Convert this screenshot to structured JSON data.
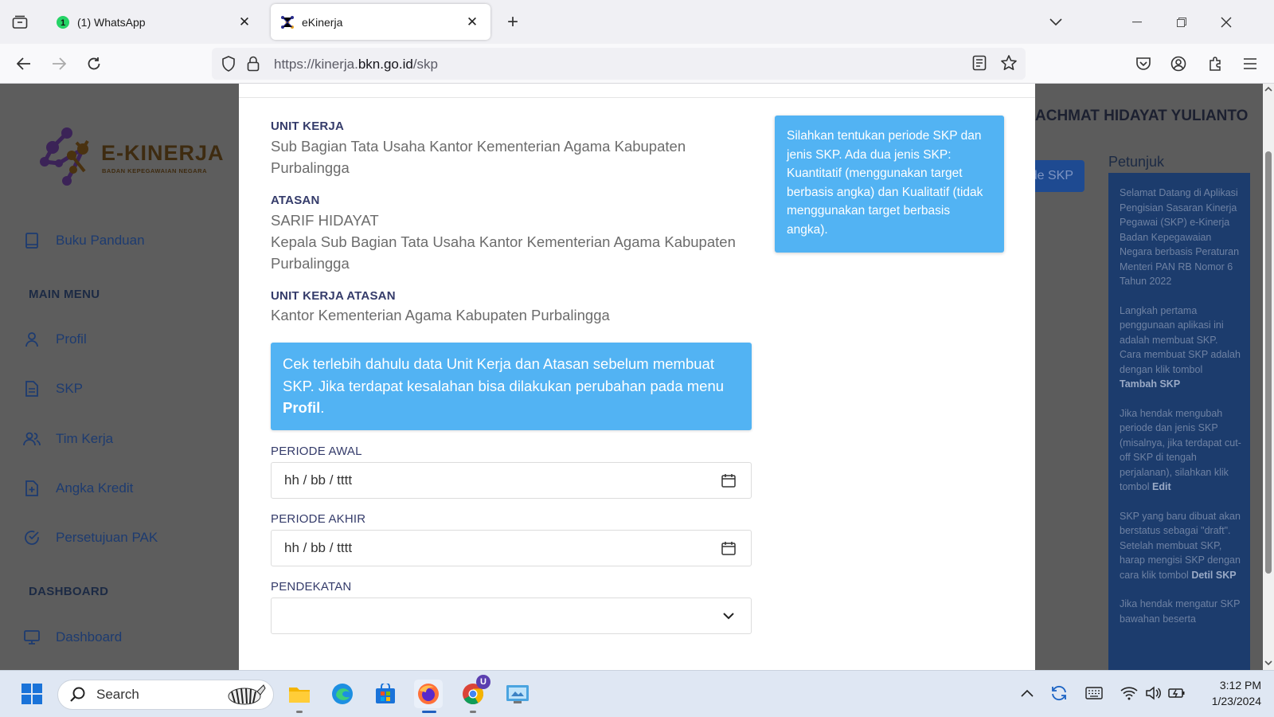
{
  "browser": {
    "tabs": [
      {
        "title": "(1) WhatsApp",
        "active": false
      },
      {
        "title": "eKinerja",
        "active": true
      }
    ],
    "url_prefix": "https://kinerja.",
    "url_domain": "bkn.go.id",
    "url_path": "/skp"
  },
  "sidebar": {
    "logo_word": "E-KINERJA",
    "logo_sub": "BADAN KEPEGAWAIAN NEGARA",
    "buku_panduan": "Buku Panduan",
    "main_menu_heading": "MAIN MENU",
    "items": [
      {
        "label": "Profil",
        "icon": "user-icon"
      },
      {
        "label": "SKP",
        "icon": "document-icon"
      },
      {
        "label": "Tim Kerja",
        "icon": "users-icon"
      },
      {
        "label": "Angka Kredit",
        "icon": "file-plus-icon"
      },
      {
        "label": "Persetujuan PAK",
        "icon": "check-circle-icon"
      }
    ],
    "dashboard_heading": "DASHBOARD",
    "dashboard": "Dashboard"
  },
  "background": {
    "username": "ACHMAT HIDAYAT YULIANTO",
    "add_button_fragment": "de SKP",
    "petunjuk_title": "Petunjuk",
    "petunjuk": {
      "p1": "Selamat Datang di Aplikasi Pengisian Sasaran Kinerja Pegawai (SKP) e-Kinerja Badan Kepegawaian Negara berbasis Peraturan Menteri PAN RB Nomor 6 Tahun 2022",
      "p2_pre": "Langkah pertama penggunaan aplikasi ini adalah membuat SKP. Cara membuat SKP adalah dengan klik tombol ",
      "p2_bold": "Tambah SKP",
      "p3_pre": "Jika hendak mengubah periode dan jenis SKP (misalnya, jika terdapat cut-off SKP di tengah perjalanan), silahkan klik tombol ",
      "p3_bold": "Edit",
      "p4_pre": "SKP yang baru dibuat akan berstatus sebagai \"draft\". Setelah membuat SKP, harap mengisi SKP dengan cara klik tombol ",
      "p4_bold": "Detil SKP",
      "p5": "Jika hendak mengatur SKP bawahan beserta"
    }
  },
  "modal": {
    "unit_kerja_label": "UNIT KERJA",
    "unit_kerja_value": "Sub Bagian Tata Usaha Kantor Kementerian Agama Kabupaten Purbalingga",
    "atasan_label": "ATASAN",
    "atasan_name": "SARIF HIDAYAT",
    "atasan_position": "Kepala Sub Bagian Tata Usaha Kantor Kementerian Agama Kabupaten Purbalingga",
    "unit_kerja_atasan_label": "UNIT KERJA ATASAN",
    "unit_kerja_atasan_value": "Kantor Kementerian Agama Kabupaten Purbalingga",
    "notice_text": "Cek terlebih dahulu data Unit Kerja dan Atasan sebelum membuat SKP. Jika terdapat kesalahan bisa dilakukan perubahan pada menu ",
    "notice_bold": "Profil",
    "notice_end": ".",
    "tip_text": "Silahkan tentukan periode SKP dan jenis SKP. Ada dua jenis SKP: Kuantitatif (menggunakan target berbasis angka) dan Kualitatif (tidak menggunakan target berbasis angka).",
    "periode_awal_label": "PERIODE AWAL",
    "periode_awal_value": "hh / bb / tttt",
    "periode_akhir_label": "PERIODE AKHIR",
    "periode_akhir_value": "hh / bb / tttt",
    "pendekatan_label": "PENDEKATAN",
    "pendekatan_value": ""
  },
  "taskbar": {
    "search_placeholder": "Search",
    "chrome_badge": "U",
    "time": "3:12 PM",
    "date": "1/23/2024"
  },
  "colors": {
    "accent_blue": "#52b3f3",
    "label_navy": "#343b6a",
    "overlay_gray": "#5c5c5c"
  }
}
